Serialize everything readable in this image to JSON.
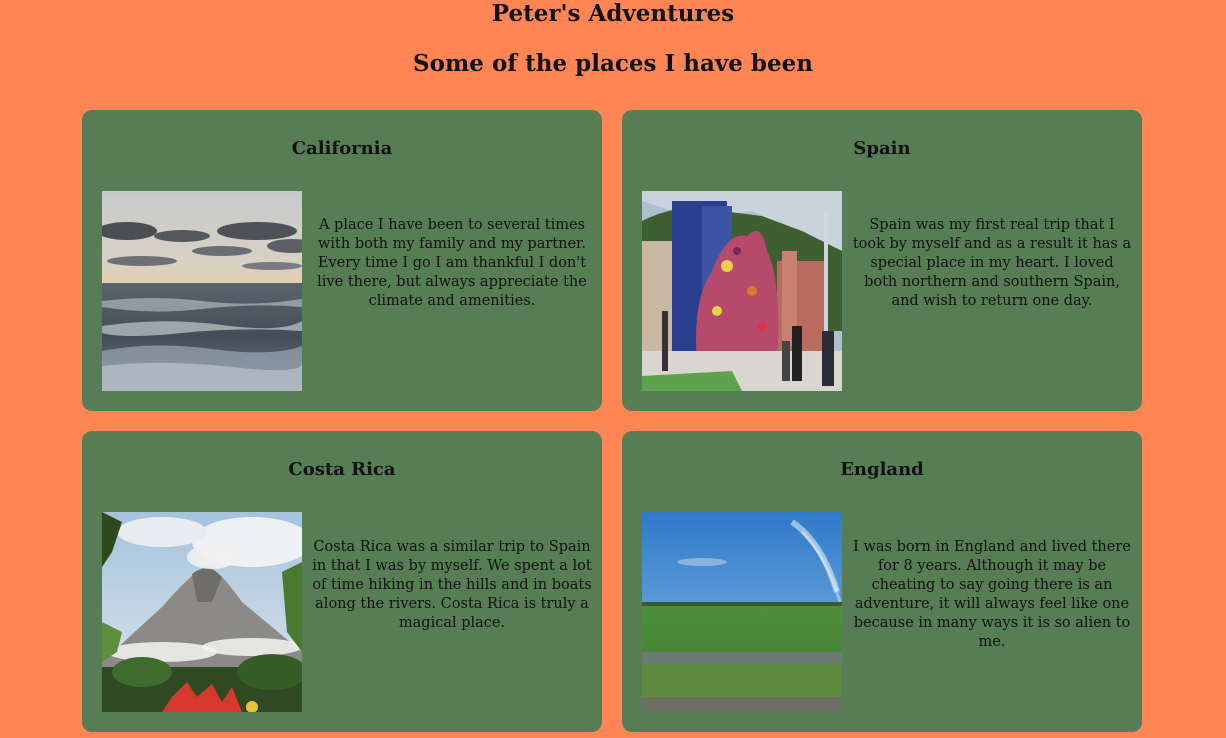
{
  "header": {
    "title": "Peter's Adventures",
    "subtitle": "Some of the places I have been"
  },
  "places": [
    {
      "name": "California",
      "photo": "ocean-sunset-photo",
      "description": "A place I have been to several times with both my family and my partner. Every time I go I am thankful I don't live there, but always appreciate the climate and amenities."
    },
    {
      "name": "Spain",
      "photo": "flower-puppy-sculpture-photo",
      "description": "Spain was my first real trip that I took by myself and as a result it has a special place in my heart. I loved both northern and southern Spain, and wish to return one day."
    },
    {
      "name": "Costa Rica",
      "photo": "volcano-photo",
      "description": "Costa Rica was a similar trip to Spain in that I was by myself. We spent a lot of time hiking in the hills and in boats along the rivers. Costa Rica is truly a magical place."
    },
    {
      "name": "England",
      "photo": "green-field-photo",
      "description": "I was born in England and lived there for 8 years. Although it may be cheating to say going there is an adventure, it will always feel like one because in many ways it is so alien to me."
    }
  ],
  "colors": {
    "page_background": "#ff8555",
    "card_background": "#567d54",
    "text": "#111111"
  }
}
